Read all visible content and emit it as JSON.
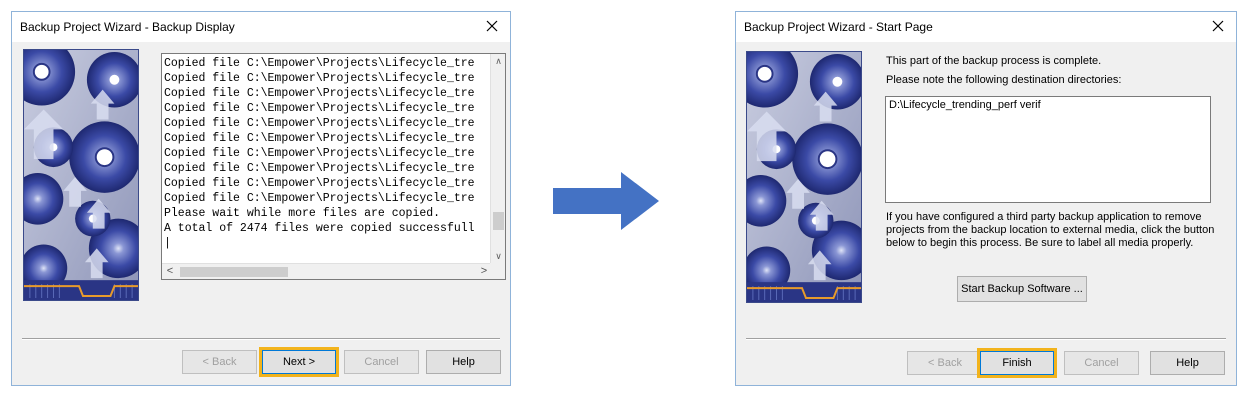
{
  "dialog1": {
    "title": "Backup Project Wizard - Backup Display",
    "log_lines": [
      "Copied file C:\\Empower\\Projects\\Lifecycle_tre",
      "Copied file C:\\Empower\\Projects\\Lifecycle_tre",
      "Copied file C:\\Empower\\Projects\\Lifecycle_tre",
      "Copied file C:\\Empower\\Projects\\Lifecycle_tre",
      "Copied file C:\\Empower\\Projects\\Lifecycle_tre",
      "Copied file C:\\Empower\\Projects\\Lifecycle_tre",
      "Copied file C:\\Empower\\Projects\\Lifecycle_tre",
      "Copied file C:\\Empower\\Projects\\Lifecycle_tre",
      "Copied file C:\\Empower\\Projects\\Lifecycle_tre",
      "Copied file C:\\Empower\\Projects\\Lifecycle_tre",
      "Please wait while more files are copied.",
      "A total of 2474 files were copied successfull"
    ],
    "buttons": {
      "back": "< Back",
      "next": "Next >",
      "cancel": "Cancel",
      "help": "Help"
    },
    "highlighted_button": "next"
  },
  "dialog2": {
    "title": "Backup Project Wizard - Start Page",
    "complete_text": "This part of the backup process is complete.",
    "note_text": "Please note the following destination directories:",
    "destination": "D:\\Lifecycle_trending_perf verif",
    "info_lines": [
      "If you have configured a third party backup application to remove",
      "projects from the backup location to external media, click the button",
      "below to begin this process.  Be sure to label all media properly."
    ],
    "start_backup_label": "Start Backup Software ...",
    "buttons": {
      "back": "< Back",
      "finish": "Finish",
      "cancel": "Cancel",
      "help": "Help"
    },
    "highlighted_button": "finish"
  },
  "colors": {
    "highlight": "#f2b31c",
    "arrow": "#4472c4",
    "art_blue": "#2e3d8f"
  }
}
